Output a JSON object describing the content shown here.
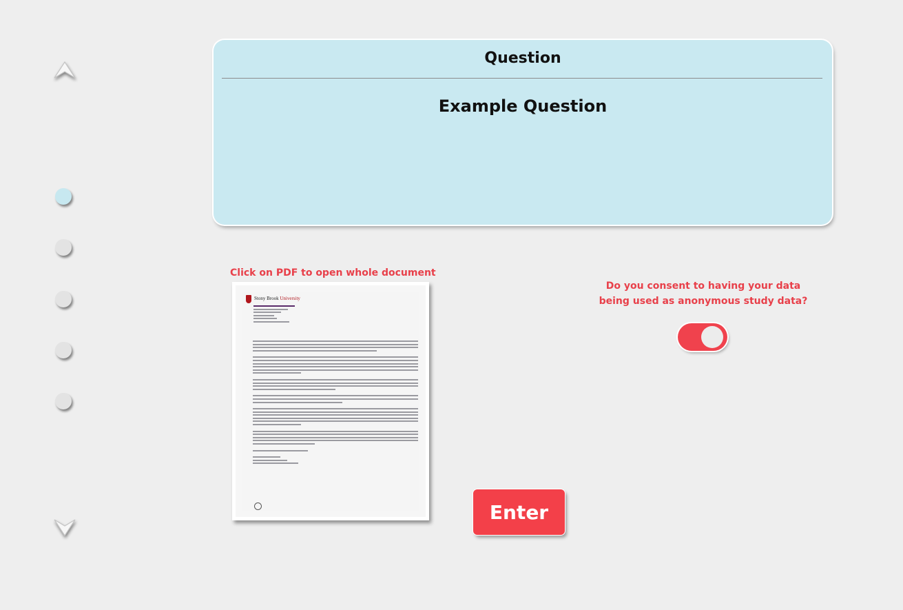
{
  "nav": {
    "up_icon": "chevron-up-icon",
    "down_icon": "chevron-down-icon",
    "steps": [
      {
        "state": "active"
      },
      {
        "state": "inactive"
      },
      {
        "state": "inactive"
      },
      {
        "state": "inactive"
      },
      {
        "state": "inactive"
      }
    ]
  },
  "question": {
    "heading": "Question",
    "text": "Example Question"
  },
  "pdf": {
    "hint": "Click on PDF to open whole document",
    "institution_a": "Stony Brook",
    "institution_b": "University"
  },
  "consent": {
    "question": "Do you consent to having your data being used as anonymous study data?",
    "toggle_on": true
  },
  "enter_button": {
    "label": "Enter"
  },
  "colors": {
    "background": "#eeeeee",
    "card": "#c9e9f1",
    "accent": "#f34049",
    "hint_red": "#e8404a"
  }
}
